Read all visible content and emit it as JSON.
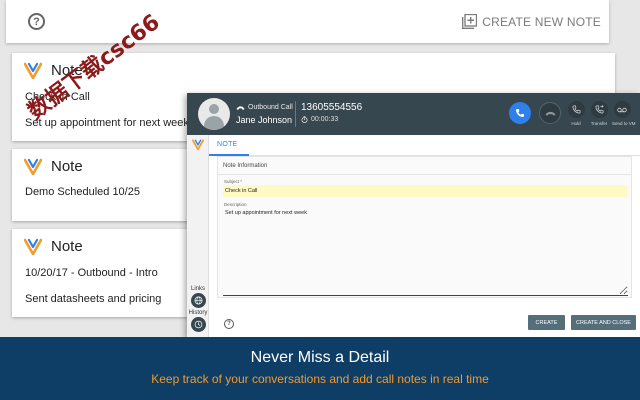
{
  "app": {
    "create_note_label": "CREATE NEW NOTE"
  },
  "notes": [
    {
      "title": "Note",
      "lines": [
        "Check in Call",
        "Set up appointment for next week"
      ]
    },
    {
      "title": "Note",
      "lines": [
        "Demo Scheduled 10/25"
      ]
    },
    {
      "title": "Note",
      "lines": [
        "10/20/17 - Outbound - Intro",
        "Sent datasheets and pricing"
      ]
    }
  ],
  "watermark": "数据下载csc66",
  "call": {
    "type": "Outbound Call",
    "caller_name": "Jane Johnson",
    "number": "13605554556",
    "timer": "00:00:33",
    "controls": [
      "Hold",
      "Transfer",
      "Send to VM"
    ],
    "tab": "NOTE",
    "section_title": "Note Information",
    "subject_label": "Subject *",
    "subject_value": "Check in Call",
    "description_label": "Description",
    "description_value": "Set up appointment for next week",
    "rail_links_label": "Links",
    "rail_history_label": "History",
    "create_button": "CREATE",
    "create_close_button": "CREATE AND CLOSE"
  },
  "banner": {
    "title": "Never Miss a Detail",
    "subtitle": "Keep track of your conversations and add call notes in real time"
  },
  "colors": {
    "brand_blue": "#2f80ed",
    "brand_orange": "#f59a2a",
    "header_dark": "#37474f",
    "banner_navy": "#0e3d66"
  },
  "icons": [
    "help-icon",
    "add-note-icon",
    "logo-v-icon",
    "phone-icon",
    "timer-icon",
    "hold-icon",
    "transfer-icon",
    "voicemail-icon",
    "globe-icon",
    "history-icon"
  ]
}
